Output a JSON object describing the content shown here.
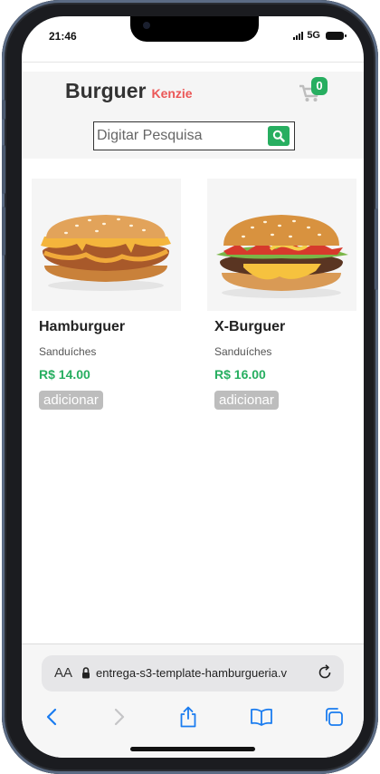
{
  "status_bar": {
    "time": "21:46",
    "network": "5G"
  },
  "header": {
    "brand_main": "Burguer",
    "brand_sub": "Kenzie",
    "cart_count": "0",
    "search_placeholder": "Digitar Pesquisa"
  },
  "products": [
    {
      "name": "Hamburguer",
      "category": "Sanduíches",
      "price": "R$ 14.00",
      "button": "adicionar",
      "image": "hamburger-image"
    },
    {
      "name": "X-Burguer",
      "category": "Sanduíches",
      "price": "R$ 16.00",
      "button": "adicionar",
      "image": "x-burger-image"
    }
  ],
  "browser": {
    "text_size_label": "AA",
    "url": "entrega-s3-template-hamburgueria.v"
  },
  "colors": {
    "accent_green": "#27ae60",
    "brand_red": "#eb5757",
    "browser_blue": "#1a7cf0"
  }
}
